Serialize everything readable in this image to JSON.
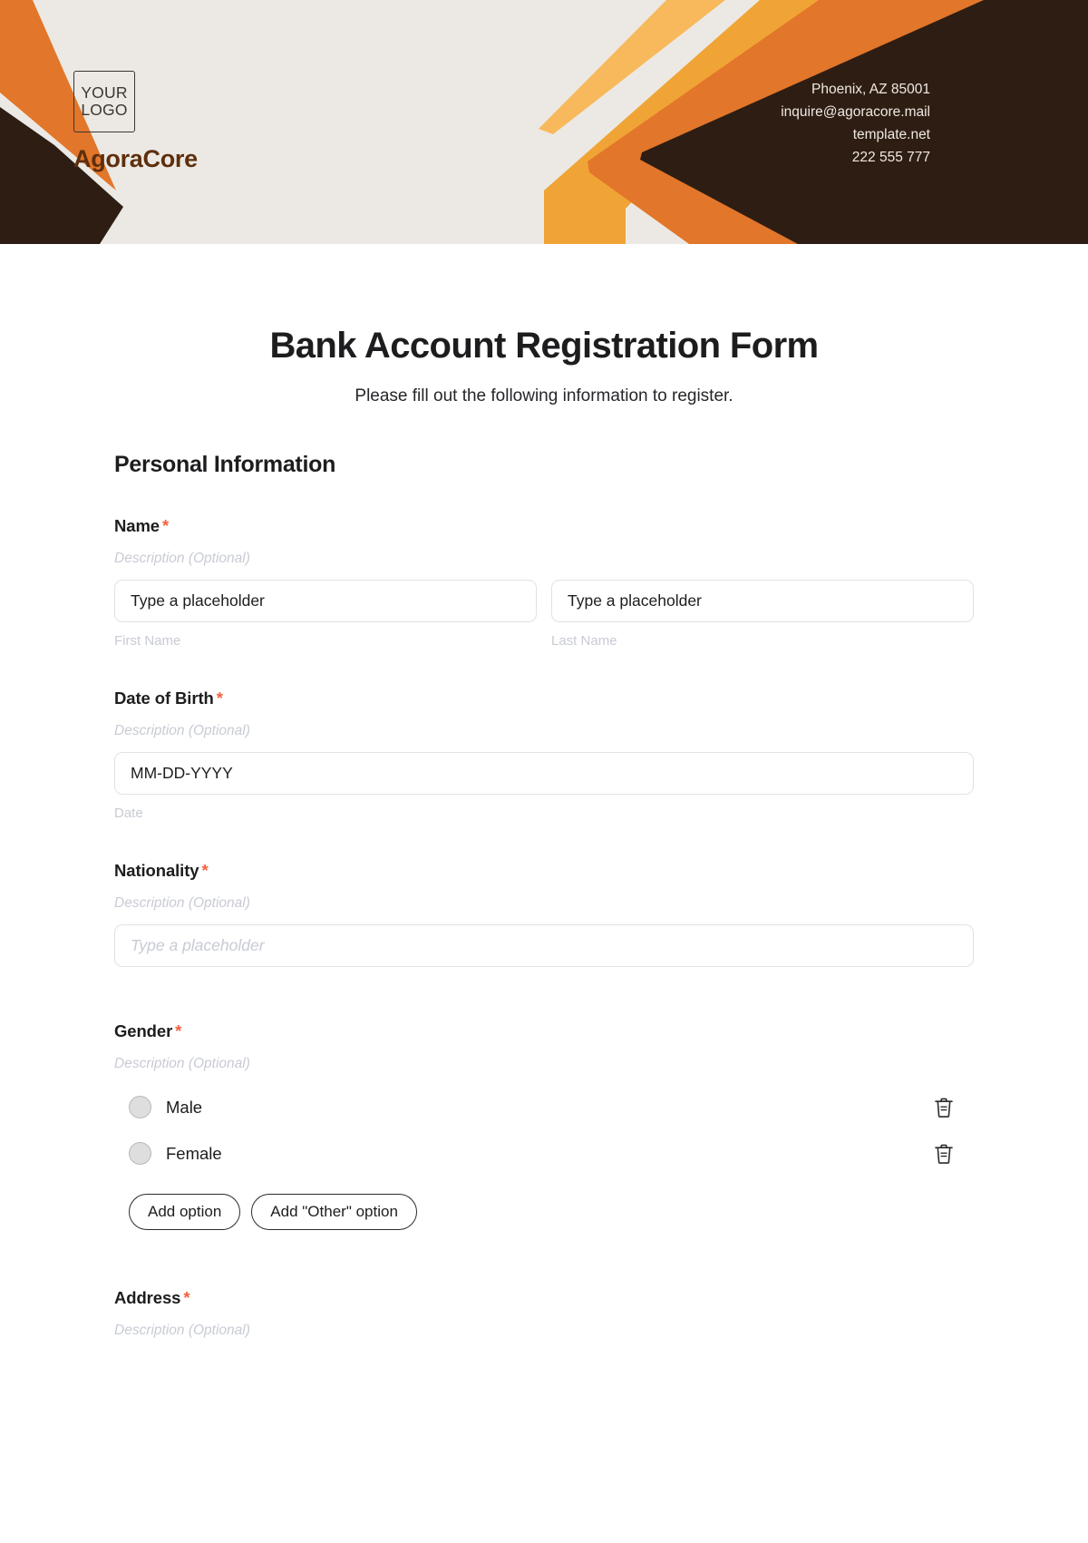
{
  "header": {
    "logo_line1": "YOUR",
    "logo_line2": "LOGO",
    "brand_name": "AgoraCore",
    "contact": {
      "address": "Phoenix, AZ 85001",
      "email": "inquire@agoracore.mail",
      "website": "template.net",
      "phone": "222 555 777"
    },
    "colors": {
      "background": "#ece9e4",
      "dark_brown": "#2e1d13",
      "orange": "#e2762a",
      "amber": "#f0a435",
      "light_amber": "#f7b95b",
      "brand_text": "#5e2f0d"
    }
  },
  "form": {
    "title": "Bank Account Registration Form",
    "subtitle": "Please fill out the following information to register.",
    "section_title": "Personal Information",
    "required_marker": "*",
    "description_placeholder": "Description (Optional)",
    "fields": [
      {
        "label": "Name",
        "required": true,
        "description": "Description (Optional)",
        "type": "two-column-text",
        "inputs": [
          {
            "value": "Type a placeholder",
            "sub_label": "First Name",
            "is_placeholder": false
          },
          {
            "value": "Type a placeholder",
            "sub_label": "Last Name",
            "is_placeholder": false
          }
        ]
      },
      {
        "label": "Date of Birth",
        "required": true,
        "description": "Description (Optional)",
        "type": "date",
        "inputs": [
          {
            "value": "MM-DD-YYYY",
            "sub_label": "Date",
            "is_placeholder": false
          }
        ]
      },
      {
        "label": "Nationality",
        "required": true,
        "description": "Description (Optional)",
        "type": "text",
        "inputs": [
          {
            "value": "Type a placeholder",
            "sub_label": "",
            "is_placeholder": true
          }
        ]
      },
      {
        "label": "Gender",
        "required": true,
        "description": "Description (Optional)",
        "type": "radio",
        "options": [
          {
            "label": "Male",
            "selected": false,
            "delete_icon": "trash-icon"
          },
          {
            "label": "Female",
            "selected": false,
            "delete_icon": "trash-icon"
          }
        ],
        "add_option_label": "Add option",
        "add_other_option_label": "Add \"Other\" option"
      },
      {
        "label": "Address",
        "required": true,
        "description": "Description (Optional)",
        "type": "text",
        "inputs": []
      }
    ]
  },
  "accent_colors": {
    "required_asterisk": "#f4613f",
    "placeholder_gray": "#c8cbd4",
    "input_border": "#dfe2e8",
    "text_dark": "#1d1d1f"
  }
}
